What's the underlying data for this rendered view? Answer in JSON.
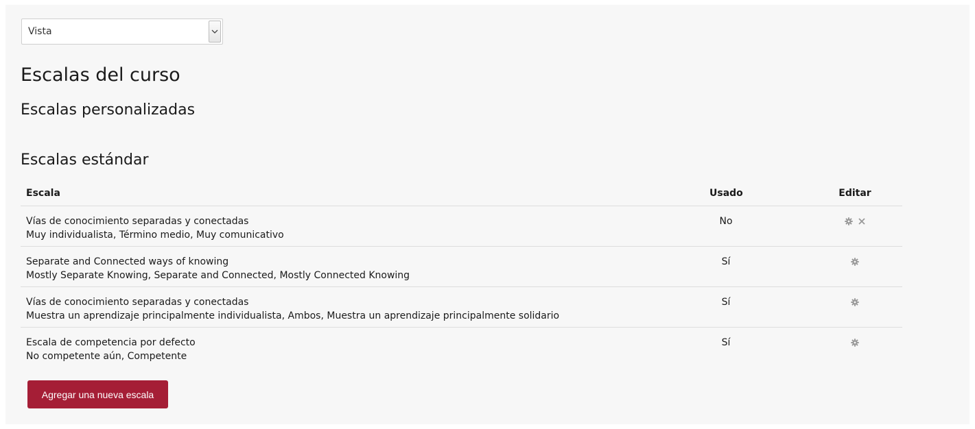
{
  "view_select": {
    "value": "Vista"
  },
  "page": {
    "title": "Escalas del curso",
    "custom_heading": "Escalas personalizadas",
    "standard_heading": "Escalas estándar"
  },
  "table": {
    "headers": {
      "scale": "Escala",
      "used": "Usado",
      "edit": "Editar"
    },
    "rows": [
      {
        "name": "Vías de conocimiento separadas y conectadas",
        "items": "Muy individualista, Término medio, Muy comunicativo",
        "used": "No",
        "actions": [
          "gear-icon",
          "delete-icon"
        ]
      },
      {
        "name": "Separate and Connected ways of knowing",
        "items": "Mostly Separate Knowing, Separate and Connected, Mostly Connected Knowing",
        "used": "Sí",
        "actions": [
          "gear-icon"
        ]
      },
      {
        "name": "Vías de conocimiento separadas y conectadas",
        "items": "Muestra un aprendizaje principalmente individualista, Ambos, Muestra un aprendizaje principalmente solidario",
        "used": "Sí",
        "actions": [
          "gear-icon"
        ]
      },
      {
        "name": "Escala de competencia por defecto",
        "items": "No competente aún, Competente",
        "used": "Sí",
        "actions": [
          "gear-icon"
        ]
      }
    ]
  },
  "add_button": {
    "label": "Agregar una nueva escala"
  },
  "colors": {
    "panel_background": "#f7f7f7",
    "accent_button": "#a51e36",
    "icon_grey": "#999999",
    "divider": "#dddddd"
  }
}
